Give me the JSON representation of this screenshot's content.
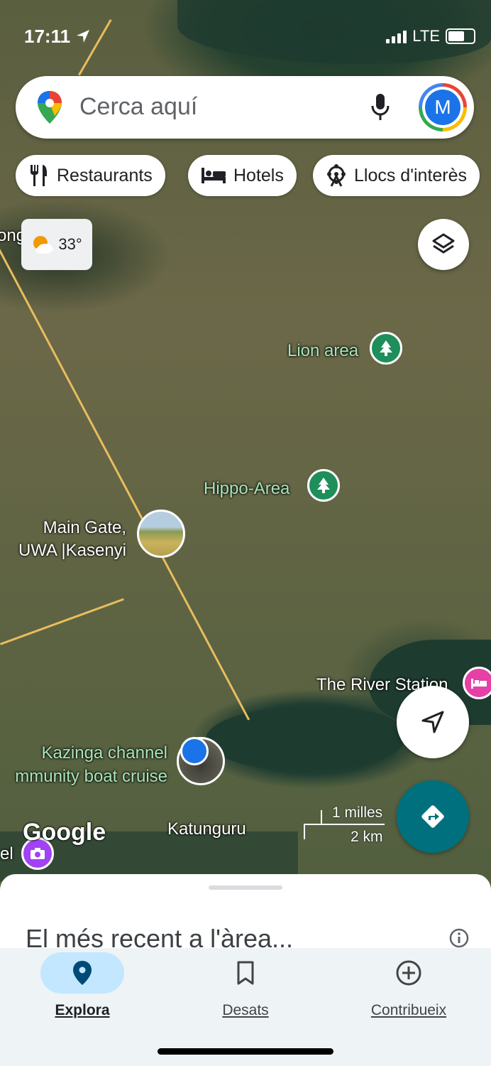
{
  "status": {
    "time": "17:11",
    "network": "LTE"
  },
  "search": {
    "placeholder": "Cerca aquí",
    "avatar_letter": "M",
    "icons": [
      "google-maps-pin-icon",
      "microphone-icon"
    ]
  },
  "chips": [
    {
      "label": "Restaurants",
      "icon": "fork-knife-icon"
    },
    {
      "label": "Hotels",
      "icon": "bed-icon"
    },
    {
      "label": "Llocs d'interès",
      "icon": "ferris-wheel-icon"
    }
  ],
  "weather": {
    "temp": "33°",
    "icon": "partly-cloudy-icon"
  },
  "map": {
    "labels": {
      "lion": "Lion area",
      "hippo": "Hippo-Area",
      "main_gate_1": "Main Gate,",
      "main_gate_2": "UWA |Kasenyi",
      "river_station": "The River Station",
      "kazinga_1": "Kazinga channel",
      "kazinga_2": "mmunity boat cruise",
      "katunguru": "Katunguru",
      "google": "Google",
      "partial_left": "el",
      "partial_top": "ong"
    },
    "scale": {
      "miles": "1 milles",
      "km": "2 km"
    }
  },
  "sheet": {
    "title": "El més recent a l'àrea..."
  },
  "nav": {
    "explore": "Explora",
    "saved": "Desats",
    "contribute": "Contribueix"
  },
  "colors": {
    "accent": "#00707f",
    "nav_active": "#c2e7ff",
    "poi_green": "#1e8e5a",
    "road": "#e8bd5e"
  }
}
